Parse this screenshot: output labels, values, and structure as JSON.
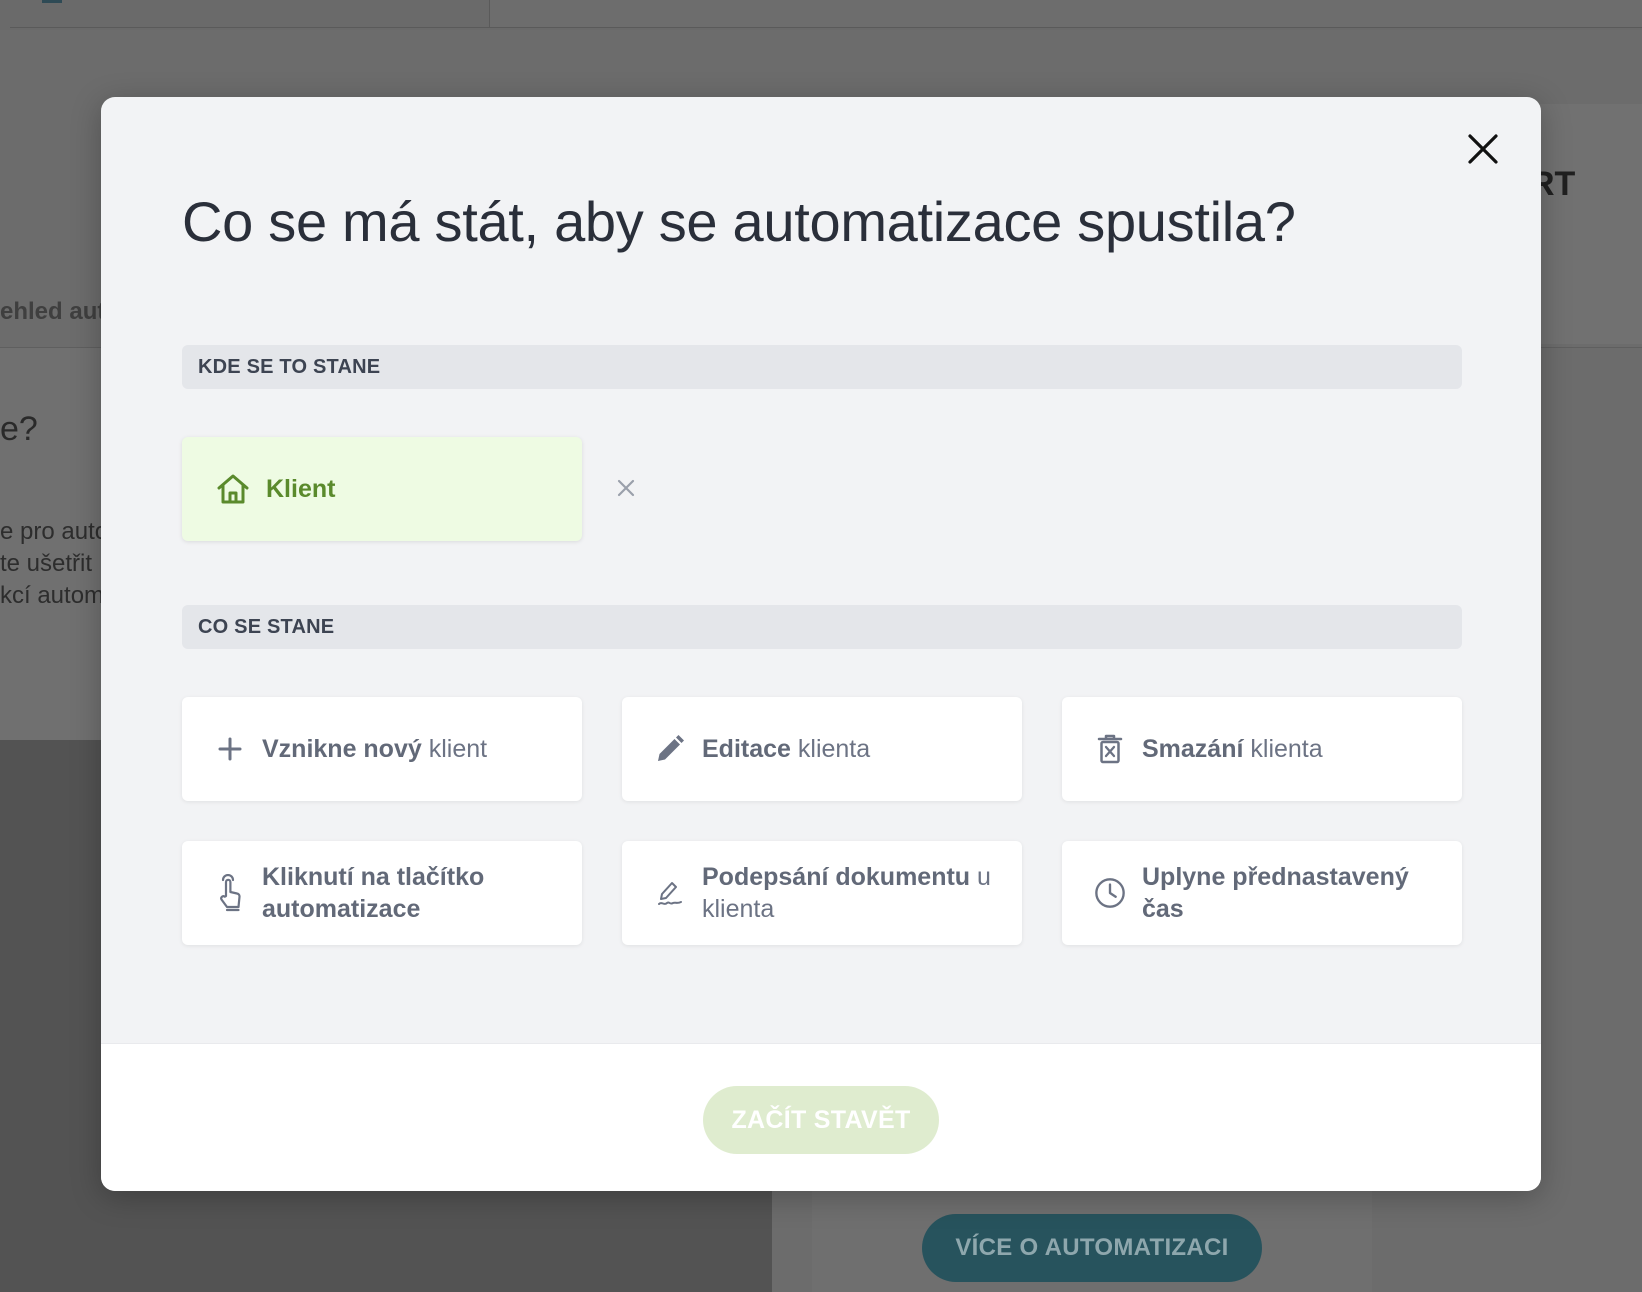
{
  "background": {
    "nav_text": "ehled aut",
    "right_card_text": "RT",
    "heading_fragment": "e?",
    "paragraph_lines": [
      "e pro auto",
      "te ušetřit",
      "kcí autom"
    ],
    "card_button": "VÍCE O AUTOMATIZACI"
  },
  "modal": {
    "title": "Co se má stát, aby se automatizace spustila?",
    "where_section": "KDE SE TO STANE",
    "selected_entity": {
      "label": "Klient",
      "icon": "home-icon"
    },
    "what_section": "CO SE STANE",
    "options": [
      {
        "icon": "plus-icon",
        "bold": "Vznikne nový",
        "rest": " klient"
      },
      {
        "icon": "pencil-icon",
        "bold": "Editace",
        "rest": " klienta"
      },
      {
        "icon": "trash-icon",
        "bold": "Smazání",
        "rest": " klienta"
      },
      {
        "icon": "pointer-hand-icon",
        "bold": "Kliknutí na tlačítko automatizace",
        "rest": ""
      },
      {
        "icon": "signature-icon",
        "bold": "Podepsání dokumentu",
        "rest": " u klienta"
      },
      {
        "icon": "clock-icon",
        "bold": "Uplyne přednastavený čas",
        "rest": ""
      }
    ],
    "start_button": "ZAČÍT STAVĚT"
  },
  "colors": {
    "accent_green": "#5a8a2c",
    "selected_bg": "#eefbe3",
    "start_button_disabled": "#dfeccf",
    "bg_button_teal": "#27535d"
  }
}
